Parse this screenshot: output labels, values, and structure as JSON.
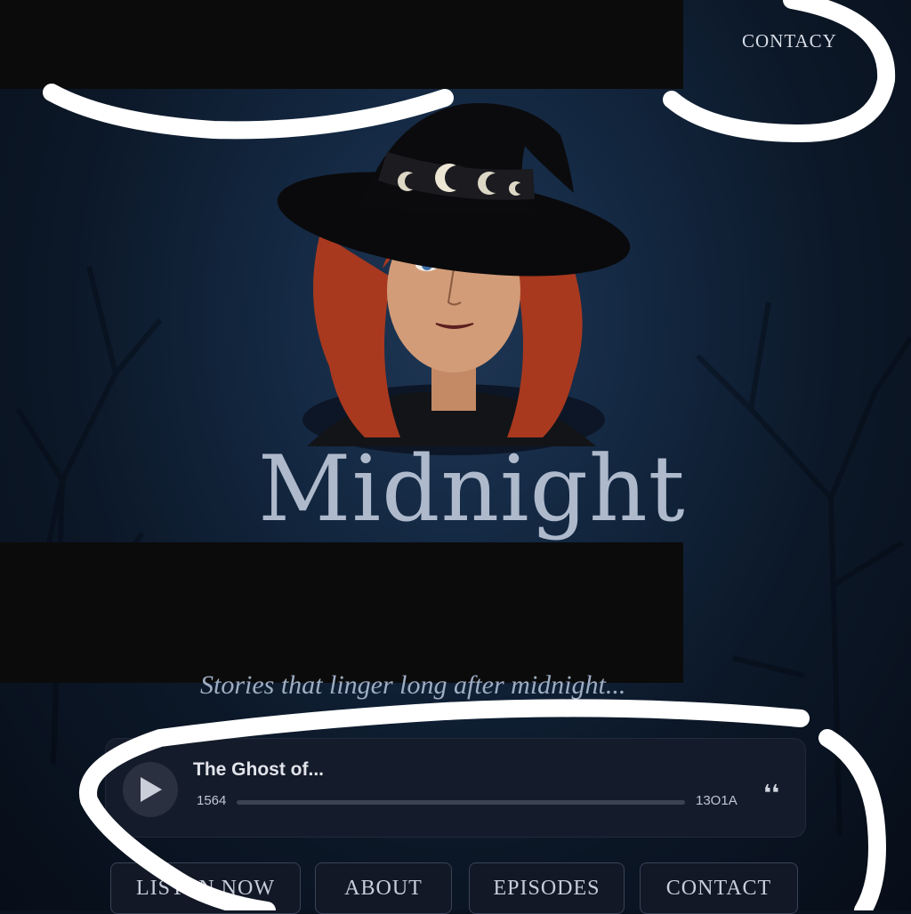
{
  "header": {
    "nav_contact": "CONTACY"
  },
  "hero": {
    "title": "Midnight",
    "tagline": "Stories that linger long after midnight..."
  },
  "player": {
    "track_title": "The Ghost of...",
    "current_time": "1564",
    "total_time": "13O1A",
    "progress": 0
  },
  "buttons": {
    "listen_now": "LISTEN NOW",
    "about": "ABOUT",
    "episodes": "EPISODES",
    "contact": "CONTACT"
  },
  "colors": {
    "background": "#0b1220",
    "title": "#aeb9cc",
    "hair": "#b8412a",
    "annotation": "#ffffff"
  }
}
